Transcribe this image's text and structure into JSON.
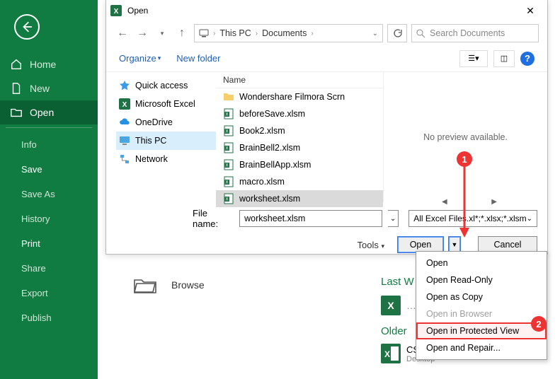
{
  "sidebar": {
    "items": [
      {
        "label": "Home"
      },
      {
        "label": "New"
      },
      {
        "label": "Open"
      }
    ],
    "subitems": [
      {
        "label": "Info"
      },
      {
        "label": "Save"
      },
      {
        "label": "Save As"
      },
      {
        "label": "History"
      },
      {
        "label": "Print"
      },
      {
        "label": "Share"
      },
      {
        "label": "Export"
      },
      {
        "label": "Publish"
      }
    ]
  },
  "dialog": {
    "title": "Open",
    "path": {
      "segment1": "This PC",
      "segment2": "Documents"
    },
    "search_placeholder": "Search Documents",
    "toolbar": {
      "organize": "Organize",
      "newfolder": "New folder"
    },
    "tree": [
      {
        "label": "Quick access"
      },
      {
        "label": "Microsoft Excel"
      },
      {
        "label": "OneDrive"
      },
      {
        "label": "This PC"
      },
      {
        "label": "Network"
      }
    ],
    "files_header": "Name",
    "files": [
      {
        "label": "Wondershare Filmora Scrn",
        "kind": "folder"
      },
      {
        "label": "beforeSave.xlsm",
        "kind": "xlsm"
      },
      {
        "label": "Book2.xlsm",
        "kind": "xlsm"
      },
      {
        "label": "BrainBell2.xlsm",
        "kind": "xlsm"
      },
      {
        "label": "BrainBellApp.xlsm",
        "kind": "xlsm"
      },
      {
        "label": "macro.xlsm",
        "kind": "xlsm"
      },
      {
        "label": "worksheet.xlsm",
        "kind": "xlsm"
      }
    ],
    "preview": "No preview available.",
    "filename_label": "File name:",
    "filename_value": "worksheet.xlsm",
    "filter": "All Excel Files.xl*;*.xlsx;*.xlsm",
    "tools": "Tools",
    "open_btn": "Open",
    "cancel_btn": "Cancel"
  },
  "dropdown": [
    {
      "label": "Open"
    },
    {
      "label": "Open Read-Only"
    },
    {
      "label": "Open as Copy"
    },
    {
      "label": "Open in Browser",
      "disabled": true
    },
    {
      "label": "Open in Protected View",
      "highlighted": true
    },
    {
      "label": "Open and Repair..."
    }
  ],
  "bg": {
    "browse": "Browse",
    "last_w": "Last W",
    "older": "Older",
    "csv_name": "CSV.CSV",
    "csv_sub": "Desktop"
  },
  "callouts": {
    "one": "1",
    "two": "2"
  }
}
